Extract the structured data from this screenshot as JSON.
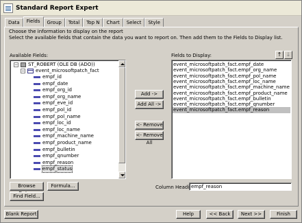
{
  "window": {
    "title": "Standard Report Expert"
  },
  "tabs": [
    "Data",
    "Fields",
    "Group",
    "Total",
    "Top N",
    "Chart",
    "Select",
    "Style"
  ],
  "active_tab": "Fields",
  "instructions": {
    "line1": "Choose the information to display on the report",
    "line2": "Select the available fields that contain the data you want to report on.  Then add them to the Fields to Display list."
  },
  "available": {
    "label": "Available Fields:",
    "root": "ST_ROBERT (OLE DB (ADO))",
    "table": "event_microsoftpatch_fact",
    "fields": [
      "empf_id",
      "empf_date",
      "empf_org_id",
      "empf_org_name",
      "empf_eve_id",
      "empf_pol_id",
      "empf_pol_name",
      "empf_loc_id",
      "empf_loc_name",
      "empf_machine_name",
      "empf_product_name",
      "empf_bulletin",
      "empf_qnumber",
      "empf_reason",
      "empf_status"
    ],
    "selected": "empf_status"
  },
  "buttons": {
    "add": "Add ->",
    "add_all": "Add All ->",
    "remove": "<- Remove",
    "remove_all": "<- Remove All",
    "browse": "Browse Data...",
    "formula": "Formula...",
    "find": "Find Field...",
    "blank_report": "Blank Report",
    "help": "Help",
    "back": "<< Back",
    "next": "Next >>",
    "finish": "Finish"
  },
  "display": {
    "label": "Fields to Display:",
    "items": [
      "event_microsoftpatch_fact.empf_date",
      "event_microsoftpatch_fact.empf_org_name",
      "event_microsoftpatch_fact.empf_pol_name",
      "event_microsoftpatch_fact.empf_loc_name",
      "event_microsoftpatch_fact.empf_machine_name",
      "event_microsoftpatch_fact.empf_product_name",
      "event_microsoftpatch_fact.empf_bulletin",
      "event_microsoftpatch_fact.empf_qnumber",
      "event_microsoftpatch_fact.empf_reason"
    ],
    "selected": "event_microsoftpatch_fact.empf_reason"
  },
  "column_heading": {
    "label": "Column Heading:",
    "value": "empf_reason"
  },
  "icons": [
    "report-icon",
    "database-icon",
    "table-icon",
    "field-icon",
    "move-up-icon",
    "move-down-icon"
  ]
}
